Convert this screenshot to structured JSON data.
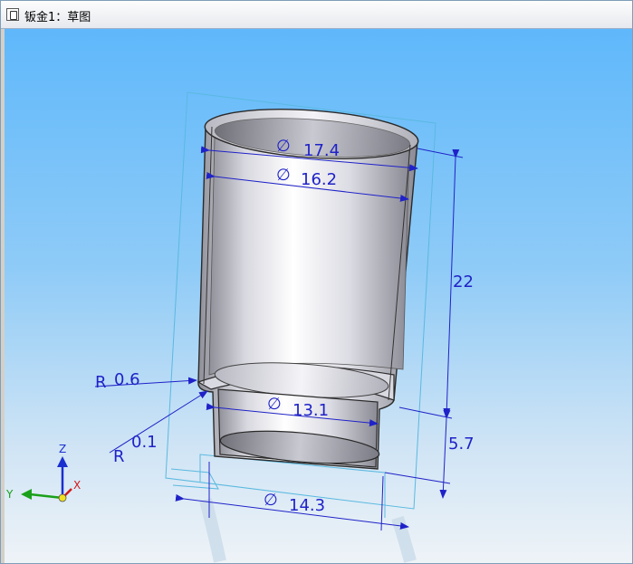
{
  "window": {
    "title": "钣金1：草图"
  },
  "dimensions": {
    "outer_diameter": "17.4",
    "inner_diameter": "16.2",
    "height_upper": "22",
    "step_radius_outer": "0.6",
    "step_radius_inner": "0.1",
    "neck_diameter": "13.1",
    "height_lower": "5.7",
    "bottom_diameter": "14.3",
    "diameter_symbol": "∅",
    "radius_prefix": "R"
  },
  "triad": {
    "z_label": "Z",
    "y_label": "Y",
    "x_label": "X"
  },
  "colors": {
    "dimension": "#1f22c8",
    "viewport_top": "#5fb8fb",
    "viewport_bottom": "#eef3f7",
    "model_edge": "#2a2a2a",
    "sketch_frame": "#5ab9e0"
  }
}
